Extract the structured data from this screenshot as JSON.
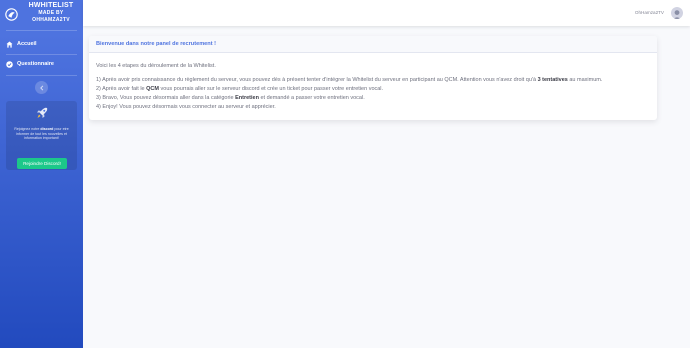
{
  "sidebar": {
    "brand": {
      "line1": "HWHITELIST",
      "line2": "MADE BY",
      "line3": "OHHAMZA2TV"
    },
    "nav": [
      {
        "label": "Accueil",
        "icon": "home-icon"
      },
      {
        "label": "Questionnaire",
        "icon": "check-circle-icon"
      }
    ],
    "promo": {
      "text_before": "Rejoignez notre ",
      "text_bold": "discord",
      "text_after": " pour etre informer de tout les nouvelles et information important!",
      "button_label": "Rejoindre Discord!"
    }
  },
  "topbar": {
    "user_name": "OhHamza2TV"
  },
  "card": {
    "title": "Bienvenue dans notre panel de recrutement !",
    "intro": "Voici les 4 etapes du déroulement de la Whitelist.",
    "step1_a": "1) Après avoir pris connaissance du règlement du serveur, vous pouvez dès à présent tenter d'intégrer la Whitelist du serveur en participant au QCM. Attention vous n'avez droit qu'à ",
    "step1_b": "3 tentatives",
    "step1_c": " au maximum.",
    "step2_a": "2) Après avoir fait le ",
    "step2_b": "QCM",
    "step2_c": " vous pourrais aller sur le serveur discord et crée un ticket pour passer votre entretien vocal.",
    "step3_a": "3) Bravo, Vous pouvez désormais aller dans la catégorie ",
    "step3_b": "Entretien",
    "step3_c": " et demandé a passer votre entretien vocal.",
    "step4": "4) Enjoy! Vous pouvez désormais vous connecter au serveur et apprécier."
  }
}
